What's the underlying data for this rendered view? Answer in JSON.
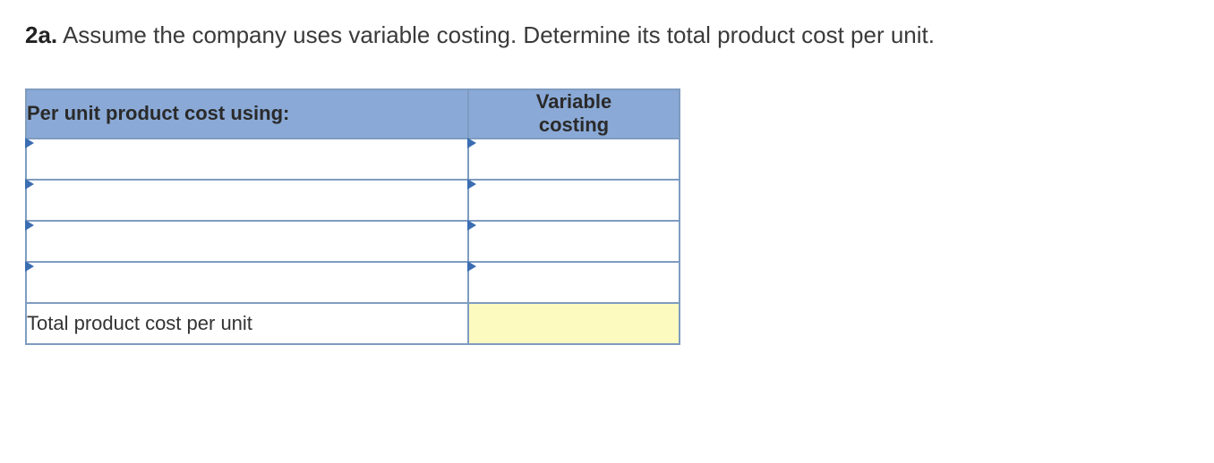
{
  "question": {
    "label": "2a.",
    "text": "Assume the company uses variable costing. Determine its total product cost per unit."
  },
  "table": {
    "header_left": "Per unit product cost using:",
    "header_right_line1": "Variable",
    "header_right_line2": "costing",
    "rows": [
      {
        "item": "",
        "value": ""
      },
      {
        "item": "",
        "value": ""
      },
      {
        "item": "",
        "value": ""
      },
      {
        "item": "",
        "value": ""
      }
    ],
    "footer_label": "Total product cost per unit",
    "footer_value": ""
  }
}
